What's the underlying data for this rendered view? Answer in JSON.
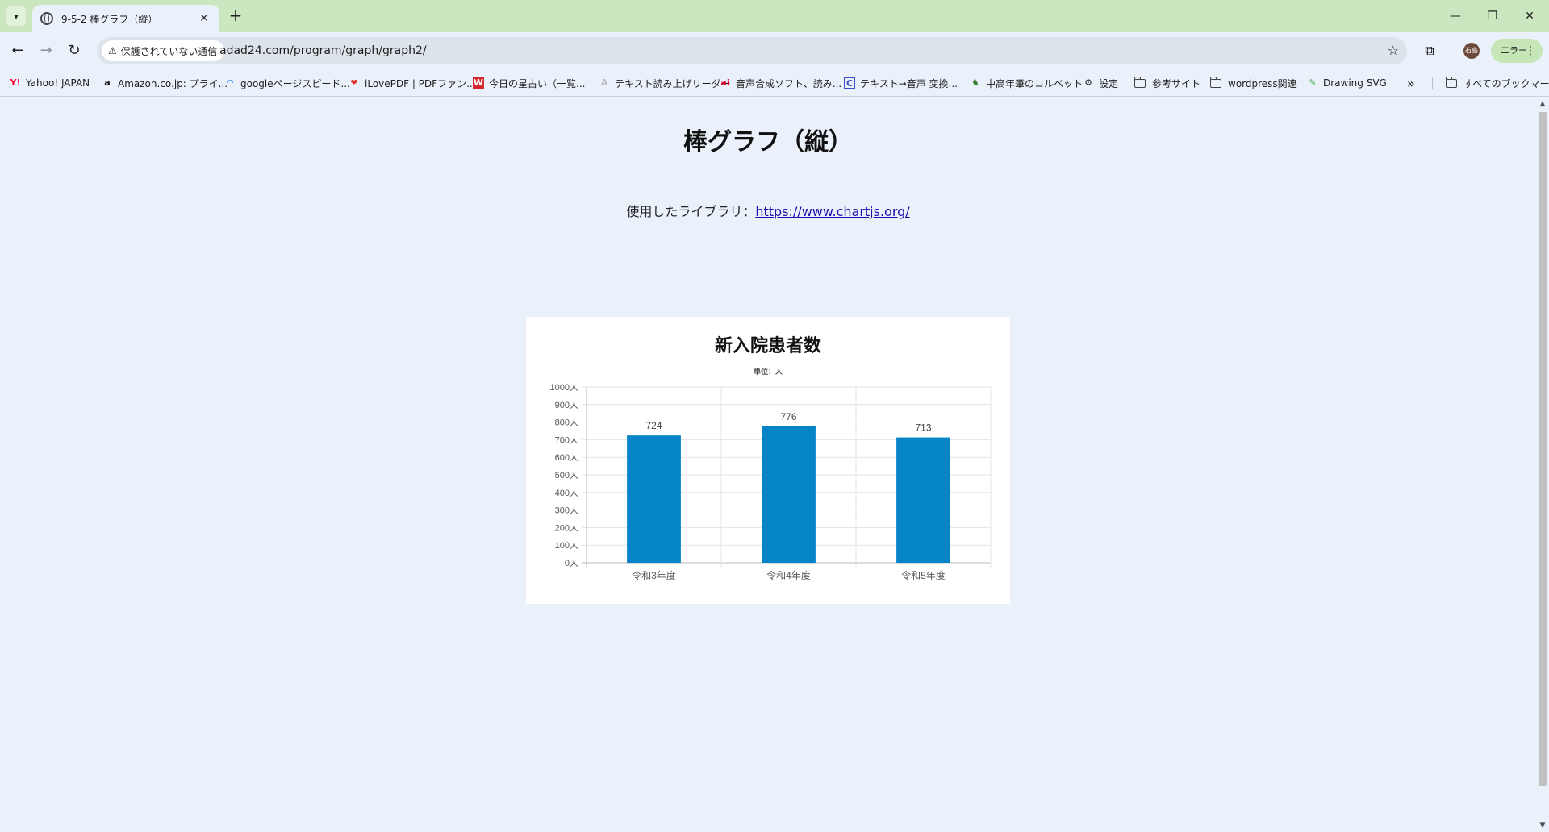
{
  "browser": {
    "tab_title": "9-5-2 棒グラフ（縦）",
    "url": "adad24.com/program/graph/graph2/",
    "security_label": "保護されていない通信",
    "profile_initials": "石島",
    "error_label": "エラー"
  },
  "bookmarks": [
    {
      "label": "Yahoo! JAPAN",
      "icon": "yahoo-icon"
    },
    {
      "label": "Amazon.co.jp: プライ...",
      "icon": "amazon-icon"
    },
    {
      "label": "googleページスピード...",
      "icon": "pagespeed-icon"
    },
    {
      "label": "iLovePDF | PDFファン...",
      "icon": "ilovepdf-icon"
    },
    {
      "label": "今日の星占い（一覧...",
      "icon": "horoscope-icon"
    },
    {
      "label": "テキスト読み上げリーダー",
      "icon": "tts-reader-icon"
    },
    {
      "label": "音声合成ソフト、読み...",
      "icon": "ai-voice-icon"
    },
    {
      "label": "テキスト→音声 変換...",
      "icon": "converter-icon"
    },
    {
      "label": "中高年筆のコルベット",
      "icon": "corvette-icon"
    },
    {
      "label": "設定",
      "icon": "gear-icon"
    },
    {
      "label": "参考サイト",
      "icon": "folder-icon"
    },
    {
      "label": "wordpress関連",
      "icon": "folder-icon"
    },
    {
      "label": "Drawing SVG",
      "icon": "svg-drawing-icon"
    }
  ],
  "all_bookmarks_label": "すべてのブックマーク",
  "page": {
    "title": "棒グラフ（縦）",
    "library_prefix": "使用したライブラリ：",
    "library_link": "https://www.chartjs.org/"
  },
  "chart_data": {
    "type": "bar",
    "title": "新入院患者数",
    "subtitle": "単位：人",
    "categories": [
      "令和3年度",
      "令和4年度",
      "令和5年度"
    ],
    "values": [
      724,
      776,
      713
    ],
    "ylim": [
      0,
      1000
    ],
    "yticks": [
      0,
      100,
      200,
      300,
      400,
      500,
      600,
      700,
      800,
      900,
      1000
    ],
    "tick_suffix": "人",
    "data_labels": true,
    "grid": true,
    "bar_color": "#0584c8"
  }
}
